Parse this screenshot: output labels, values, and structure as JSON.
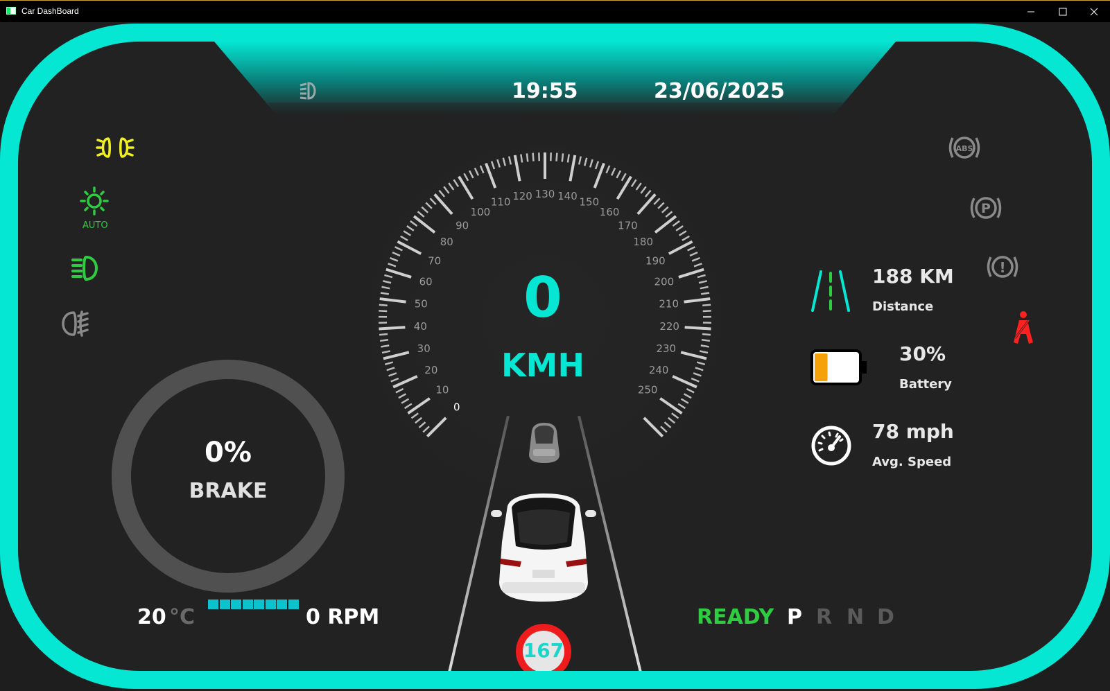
{
  "window": {
    "title": "Car DashBoard"
  },
  "header": {
    "time": "19:55",
    "date": "23/06/2025"
  },
  "indicators_left": {
    "auto_label": "AUTO"
  },
  "speedometer": {
    "speed": "0",
    "unit": "KMH",
    "ticks": [
      "0",
      "10",
      "20",
      "30",
      "40",
      "50",
      "60",
      "70",
      "80",
      "90",
      "100",
      "110",
      "120",
      "130",
      "140",
      "150",
      "160",
      "170",
      "180",
      "190",
      "200",
      "210",
      "220",
      "230",
      "240",
      "250"
    ]
  },
  "brake": {
    "percent": "0%",
    "label": "BRAKE"
  },
  "bottom_left": {
    "temperature": "20",
    "temp_unit": "°C",
    "rpm": "0 RPM",
    "rpm_bar_segments": 8
  },
  "speed_limit": "167",
  "stats": {
    "distance_value": "188 KM",
    "distance_label": "Distance",
    "battery_value": "30%",
    "battery_label": "Battery",
    "battery_level": 0.3,
    "avg_speed_value": "78 mph",
    "avg_speed_label": "Avg. Speed"
  },
  "gear": {
    "status": "READY",
    "p": "P",
    "r": "R",
    "n": "N",
    "d": "D",
    "selected": "P"
  },
  "colors": {
    "accent": "#05e6d3",
    "ready": "#2ecc40",
    "warning_red": "#ff2020",
    "highbeam": "#f0f020",
    "battery": "#f5a20a"
  }
}
